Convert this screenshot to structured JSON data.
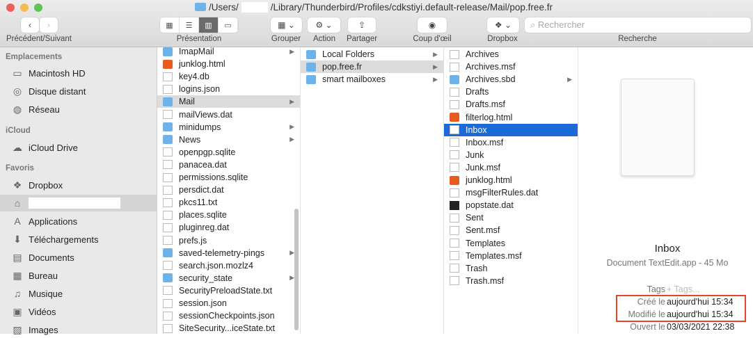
{
  "window": {
    "path_prefix": "/Users/",
    "path_suffix": "/Library/Thunderbird/Profiles/cdkstiyi.default-release/Mail/pop.free.fr"
  },
  "toolbar": {
    "back_forward": "Précédent/Suivant",
    "view": "Présentation",
    "group": "Grouper",
    "action": "Action",
    "share": "Partager",
    "quicklook": "Coup d'œil",
    "dropbox": "Dropbox",
    "search_label": "Recherche",
    "search_placeholder": "Rechercher"
  },
  "sidebar": {
    "sections": [
      {
        "title": "Emplacements",
        "items": [
          {
            "label": "Macintosh HD",
            "icon": "hd-icon"
          },
          {
            "label": "Disque distant",
            "icon": "disc-icon"
          },
          {
            "label": "Réseau",
            "icon": "network-icon"
          }
        ]
      },
      {
        "title": "iCloud",
        "items": [
          {
            "label": "iCloud Drive",
            "icon": "cloud-icon"
          }
        ]
      },
      {
        "title": "Favoris",
        "items": [
          {
            "label": "Dropbox",
            "icon": "dropbox-icon"
          },
          {
            "label": "",
            "icon": "home-icon"
          },
          {
            "label": "Applications",
            "icon": "applications-icon"
          },
          {
            "label": "Téléchargements",
            "icon": "downloads-icon"
          },
          {
            "label": "Documents",
            "icon": "documents-icon"
          },
          {
            "label": "Bureau",
            "icon": "desktop-icon"
          },
          {
            "label": "Musique",
            "icon": "music-icon"
          },
          {
            "label": "Vidéos",
            "icon": "videos-icon"
          },
          {
            "label": "Images",
            "icon": "images-icon"
          }
        ]
      }
    ]
  },
  "columns": [
    [
      {
        "n": "ImapMail",
        "t": "fold"
      },
      {
        "n": "junklog.html",
        "t": "html"
      },
      {
        "n": "key4.db",
        "t": "doc"
      },
      {
        "n": "logins.json",
        "t": "doc"
      },
      {
        "n": "Mail",
        "t": "fold",
        "s": "gray"
      },
      {
        "n": "mailViews.dat",
        "t": "doc"
      },
      {
        "n": "minidumps",
        "t": "fold"
      },
      {
        "n": "News",
        "t": "fold"
      },
      {
        "n": "openpgp.sqlite",
        "t": "doc"
      },
      {
        "n": "panacea.dat",
        "t": "doc"
      },
      {
        "n": "permissions.sqlite",
        "t": "doc"
      },
      {
        "n": "persdict.dat",
        "t": "doc"
      },
      {
        "n": "pkcs11.txt",
        "t": "doc"
      },
      {
        "n": "places.sqlite",
        "t": "doc"
      },
      {
        "n": "pluginreg.dat",
        "t": "doc"
      },
      {
        "n": "prefs.js",
        "t": "doc"
      },
      {
        "n": "saved-telemetry-pings",
        "t": "fold"
      },
      {
        "n": "search.json.mozlz4",
        "t": "doc"
      },
      {
        "n": "security_state",
        "t": "fold"
      },
      {
        "n": "SecurityPreloadState.txt",
        "t": "doc"
      },
      {
        "n": "session.json",
        "t": "doc"
      },
      {
        "n": "sessionCheckpoints.json",
        "t": "doc"
      },
      {
        "n": "SiteSecurity...iceState.txt",
        "t": "doc"
      }
    ],
    [
      {
        "n": "Local Folders",
        "t": "fold"
      },
      {
        "n": "pop.free.fr",
        "t": "fold",
        "s": "gray"
      },
      {
        "n": "smart mailboxes",
        "t": "fold"
      }
    ],
    [
      {
        "n": "Archives",
        "t": "doc"
      },
      {
        "n": "Archives.msf",
        "t": "doc"
      },
      {
        "n": "Archives.sbd",
        "t": "fold"
      },
      {
        "n": "Drafts",
        "t": "doc"
      },
      {
        "n": "Drafts.msf",
        "t": "doc"
      },
      {
        "n": "filterlog.html",
        "t": "html"
      },
      {
        "n": "Inbox",
        "t": "doc",
        "s": "blue"
      },
      {
        "n": "Inbox.msf",
        "t": "doc"
      },
      {
        "n": "Junk",
        "t": "doc"
      },
      {
        "n": "Junk.msf",
        "t": "doc"
      },
      {
        "n": "junklog.html",
        "t": "html"
      },
      {
        "n": "msgFilterRules.dat",
        "t": "doc"
      },
      {
        "n": "popstate.dat",
        "t": "term"
      },
      {
        "n": "Sent",
        "t": "doc"
      },
      {
        "n": "Sent.msf",
        "t": "doc"
      },
      {
        "n": "Templates",
        "t": "doc"
      },
      {
        "n": "Templates.msf",
        "t": "doc"
      },
      {
        "n": "Trash",
        "t": "doc"
      },
      {
        "n": "Trash.msf",
        "t": "doc"
      }
    ]
  ],
  "preview": {
    "name": "Inbox",
    "subtitle": "Document TextEdit.app - 45 Mo",
    "meta": [
      {
        "k": "Tags",
        "v": "+ Tags..."
      },
      {
        "k": "Créé le",
        "v": "aujourd'hui 15:34"
      },
      {
        "k": "Modifié le",
        "v": "aujourd'hui 15:34"
      },
      {
        "k": "Ouvert le",
        "v": "03/03/2021 22:38"
      }
    ]
  },
  "colors": {
    "selection": "#1a6ad8",
    "highlight_box": "#e5432a"
  }
}
